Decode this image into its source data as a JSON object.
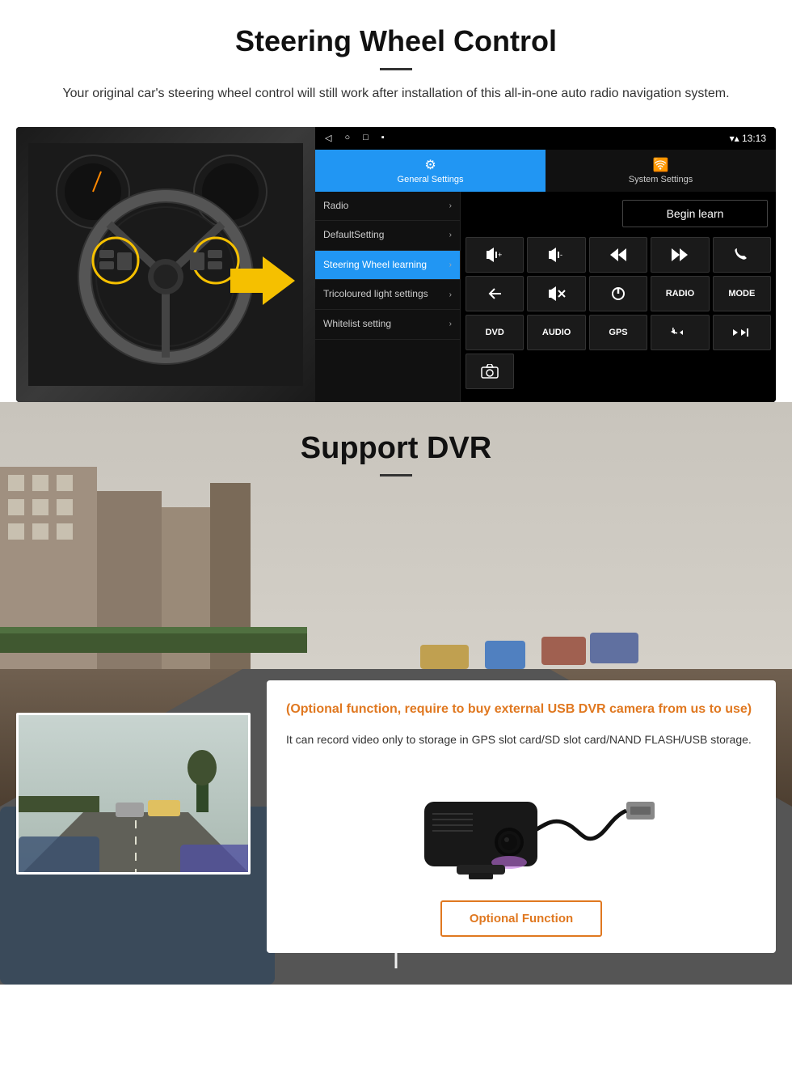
{
  "steering": {
    "title": "Steering Wheel Control",
    "subtitle": "Your original car's steering wheel control will still work after installation of this all-in-one auto radio navigation system.",
    "statusbar": {
      "time": "13:13",
      "nav_icons": [
        "◁",
        "○",
        "□",
        "▪"
      ]
    },
    "tabs": {
      "general_label": "General Settings",
      "system_label": "System Settings"
    },
    "menu_items": [
      {
        "label": "Radio",
        "active": false
      },
      {
        "label": "DefaultSetting",
        "active": false
      },
      {
        "label": "Steering Wheel learning",
        "active": true
      },
      {
        "label": "Tricoloured light settings",
        "active": false
      },
      {
        "label": "Whitelist setting",
        "active": false
      }
    ],
    "begin_learn": "Begin learn",
    "controls": [
      [
        "⏮+",
        "⏮-",
        "⏮|",
        "|▶▶",
        "📞"
      ],
      [
        "↩",
        "🔇",
        "⏻",
        "RADIO",
        "MODE"
      ],
      [
        "DVD",
        "AUDIO",
        "GPS",
        "📞⏮",
        "⏭⏭"
      ],
      [
        "📷"
      ]
    ]
  },
  "dvr": {
    "title": "Support DVR",
    "card_title": "(Optional function, require to buy external USB DVR camera from us to use)",
    "card_desc": "It can record video only to storage in GPS slot card/SD slot card/NAND FLASH/USB storage.",
    "optional_btn": "Optional Function"
  }
}
